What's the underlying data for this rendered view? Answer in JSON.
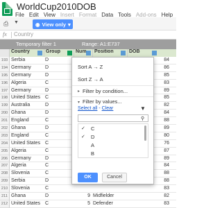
{
  "app": {
    "title": "WorldCup2010DOB",
    "menus": [
      "File",
      "Edit",
      "View",
      "Insert",
      "Format",
      "Data",
      "Tools",
      "Add-ons",
      "Help"
    ],
    "disabled_menus": [
      "Insert",
      "Format",
      "Add-ons"
    ]
  },
  "toolbar": {
    "view_only_label": "View only",
    "view_only_chevron": "▾",
    "print_glyph": "⎙",
    "filter_glyph": "▼"
  },
  "formula_bar": {
    "fx_label": "fx",
    "value": "Country"
  },
  "filter_bar": {
    "name": "Temporary filter 1",
    "range_label": "Range:",
    "range": "A1:E737"
  },
  "columns": [
    "Country",
    "Group",
    "Num",
    "Position",
    "DOB"
  ],
  "rows": [
    {
      "num": "193",
      "country": "Serbia",
      "group": "D",
      "n": "",
      "pos": "",
      "dob": "84"
    },
    {
      "num": "194",
      "country": "Germany",
      "group": "D",
      "n": "",
      "pos": "",
      "dob": "86"
    },
    {
      "num": "195",
      "country": "Germany",
      "group": "D",
      "n": "",
      "pos": "",
      "dob": "85"
    },
    {
      "num": "196",
      "country": "Algeria",
      "group": "C",
      "n": "",
      "pos": "",
      "dob": "83"
    },
    {
      "num": "197",
      "country": "Germany",
      "group": "D",
      "n": "",
      "pos": "",
      "dob": "89"
    },
    {
      "num": "198",
      "country": "United States",
      "group": "C",
      "n": "",
      "pos": "",
      "dob": "85"
    },
    {
      "num": "199",
      "country": "Australia",
      "group": "D",
      "n": "",
      "pos": "",
      "dob": "82"
    },
    {
      "num": "200",
      "country": "Ghana",
      "group": "D",
      "n": "",
      "pos": "",
      "dob": "84"
    },
    {
      "num": "201",
      "country": "England",
      "group": "C",
      "n": "",
      "pos": "",
      "dob": "88"
    },
    {
      "num": "202",
      "country": "Ghana",
      "group": "D",
      "n": "",
      "pos": "",
      "dob": "89"
    },
    {
      "num": "203",
      "country": "England",
      "group": "C",
      "n": "",
      "pos": "",
      "dob": "80"
    },
    {
      "num": "204",
      "country": "United States",
      "group": "C",
      "n": "",
      "pos": "",
      "dob": "76"
    },
    {
      "num": "205",
      "country": "Algeria",
      "group": "C",
      "n": "",
      "pos": "",
      "dob": "87"
    },
    {
      "num": "206",
      "country": "Germany",
      "group": "D",
      "n": "",
      "pos": "",
      "dob": "89"
    },
    {
      "num": "207",
      "country": "Algeria",
      "group": "C",
      "n": "",
      "pos": "",
      "dob": "84"
    },
    {
      "num": "208",
      "country": "Slovenia",
      "group": "C",
      "n": "",
      "pos": "",
      "dob": "88"
    },
    {
      "num": "209",
      "country": "Serbia",
      "group": "D",
      "n": "",
      "pos": "",
      "dob": "88"
    },
    {
      "num": "210",
      "country": "Slovenia",
      "group": "C",
      "n": "",
      "pos": "",
      "dob": "83"
    },
    {
      "num": "211",
      "country": "Ghana",
      "group": "D",
      "n": "9",
      "pos": "Midfielder",
      "dob": "82"
    },
    {
      "num": "212",
      "country": "United States",
      "group": "C",
      "n": "5",
      "pos": "Defender",
      "dob": "83"
    },
    {
      "num": "213",
      "country": "Algeria",
      "group": "C",
      "n": "19",
      "pos": "Midfielder",
      "dob": "85"
    }
  ],
  "filter_panel": {
    "sort_az": "Sort A → Z",
    "sort_za": "Sort Z → A",
    "filter_by_condition": "Filter by condition...",
    "filter_by_values": "Filter by values...",
    "select_all": "Select all",
    "link_sep": " - ",
    "clear": "Clear",
    "chevron_right": "▸",
    "chevron_down": "▾",
    "funnel_glyph": "▼",
    "search_glyph": "⚲",
    "values": [
      {
        "label": "C",
        "checked": true
      },
      {
        "label": "D",
        "checked": true
      },
      {
        "label": "A",
        "checked": false
      },
      {
        "label": "B",
        "checked": false
      }
    ],
    "check_glyph": "✓",
    "ok": "OK",
    "cancel": "Cancel"
  },
  "colors": {
    "accent": "#4d90fe",
    "brand_green": "#0f9d58",
    "filter_bar": "#9e9e9e",
    "header_bg": "#dbe8cf"
  }
}
